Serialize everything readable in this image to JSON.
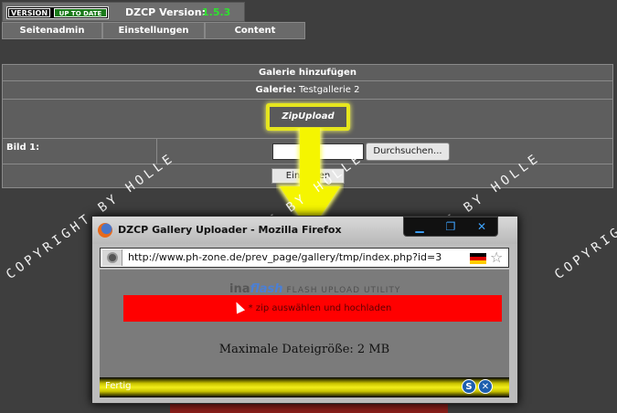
{
  "header": {
    "version_badge": "VERSION",
    "uptodate_badge": "UP TO DATE",
    "version_label": "DZCP Version:",
    "version_number": "1.5.3"
  },
  "nav": {
    "items": [
      "Seitenadmin",
      "Einstellungen",
      "Content"
    ]
  },
  "gallery": {
    "title": "Galerie hinzufügen",
    "gallery_label": "Galerie:",
    "gallery_name": "Testgallerie 2",
    "zip_upload": "ZipUpload",
    "bild_label": "Bild 1:",
    "browse_button": "Durchsuchen...",
    "submit_button": "Eintragen"
  },
  "watermark": "COPYRIGHT BY HOLLE",
  "popup": {
    "window_title": "DZCP Gallery Uploader - Mozilla Firefox",
    "url": "http://www.ph-zone.de/prev_page/gallery/tmp/index.php?id=3",
    "brand_ina": "ina",
    "brand_flash": "flash",
    "brand_util": "FLASH UPLOAD UTILITY",
    "upload_text": "* zip auswählen und hochladen",
    "max_size": "Maximale Dateigröße: 2 MB",
    "status": "Fertig"
  },
  "icons": [
    "firefox-icon",
    "minimize-icon",
    "restore-icon",
    "close-icon",
    "site-identity-icon",
    "german-flag-icon",
    "bookmark-star-icon",
    "cursor-icon",
    "s-icon",
    "x-icon",
    "yellow-arrow-icon"
  ],
  "colors": {
    "badge_green": "#1a7a1a",
    "version_green": "#2fe02f",
    "highlight_yellow": "#e6e61e",
    "upload_red": "#ff0000",
    "titlebar_blue": "#3ea3ff"
  }
}
